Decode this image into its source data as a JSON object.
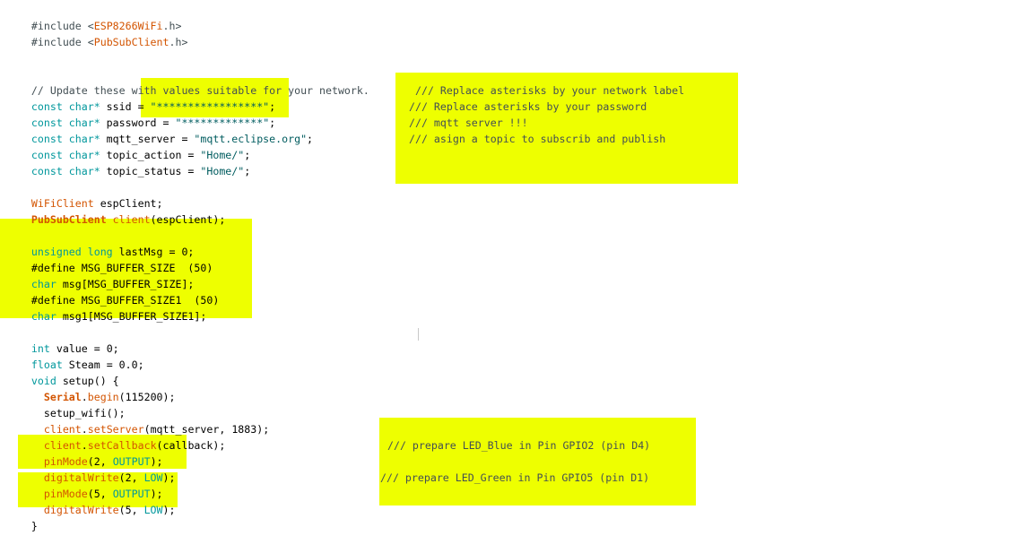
{
  "code": {
    "lines": [
      [
        "#include <",
        "ESP8266WiFi",
        ".h>"
      ],
      [
        "#include <",
        "PubSubClient",
        ".h>"
      ],
      [
        "// Update these with values suitable for your network."
      ],
      [
        "const char*",
        " ssid = ",
        "\"*****************\"",
        ";"
      ],
      [
        "const char*",
        " password = ",
        "\"*************\"",
        ";"
      ],
      [
        "const char*",
        " mqtt_server = ",
        "\"mqtt.eclipse.org\"",
        ";"
      ],
      [
        "const char*",
        " topic_action = ",
        "\"Home/\"",
        ";"
      ],
      [
        "const char*",
        " topic_status = ",
        "\"Home/\"",
        ";"
      ],
      [
        "WiFiClient",
        " espClient;"
      ],
      [
        "PubSubClient",
        " ",
        "client",
        "(espClient);"
      ],
      [
        "unsigned long",
        " lastMsg = 0;"
      ],
      [
        "#define MSG_BUFFER_SIZE  (50)"
      ],
      [
        "char",
        " msg[MSG_BUFFER_SIZE];"
      ],
      [
        "#define MSG_BUFFER_SIZE1  (50)"
      ],
      [
        "char",
        " msg1[MSG_BUFFER_SIZE1];"
      ],
      [
        "int",
        " value = 0;"
      ],
      [
        "float",
        " Steam = 0.0;"
      ],
      [
        "void",
        " setup() {"
      ],
      [
        "  ",
        "Serial",
        ".",
        "begin",
        "(115200);"
      ],
      [
        "  setup_wifi();"
      ],
      [
        "  ",
        "client",
        ".",
        "setServer",
        "(mqtt_server, 1883);"
      ],
      [
        "  ",
        "client",
        ".",
        "setCallback",
        "(callback);"
      ],
      [
        "  ",
        "pinMode",
        "(2, ",
        "OUTPUT",
        ");"
      ],
      [
        "  ",
        "digitalWrite",
        "(2, ",
        "LOW",
        ");"
      ],
      [
        "  ",
        "pinMode",
        "(5, ",
        "OUTPUT",
        ");"
      ],
      [
        "  ",
        "digitalWrite",
        "(5, ",
        "LOW",
        ");"
      ],
      [
        "}"
      ]
    ]
  },
  "notes": {
    "top": [
      " /// Replace asterisks by your network label",
      "/// Replace asterisks by your password",
      "/// mqtt server !!!",
      "/// asign a topic to subscrib and publish"
    ],
    "bottom": [
      "/// prepare LED_Blue in Pin GPIO2 (pin D4)",
      "/// prepare LED_Green in Pin GPIO5 (pin D1)"
    ]
  },
  "colors": {
    "highlight": "#eeff00",
    "keyword": "#00979c",
    "type_or_function": "#d35400",
    "string": "#005c5f",
    "comment": "#434f54"
  }
}
